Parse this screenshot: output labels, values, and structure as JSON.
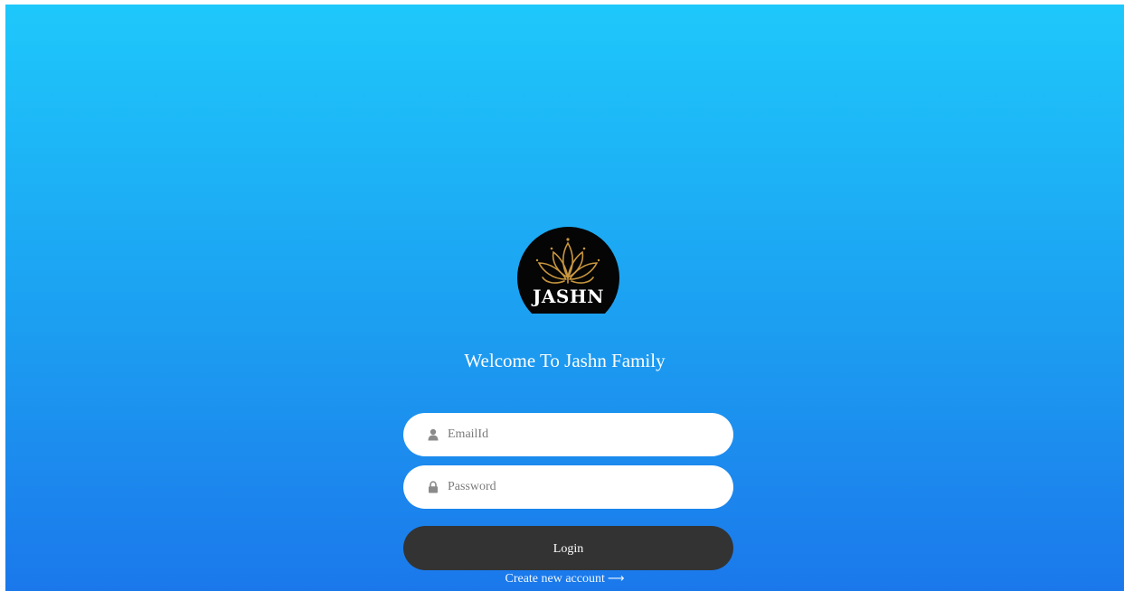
{
  "brand": {
    "logo_text": "JASHN",
    "logo_icon": "lotus-icon",
    "colors": {
      "background_top": "#1ec8fb",
      "background_bottom": "#1b78eb",
      "logo_gold": "#c8963e",
      "button_dark": "#333333"
    }
  },
  "welcome_title": "Welcome To Jashn Family",
  "form": {
    "email": {
      "placeholder": "EmailId",
      "value": "",
      "icon": "user-icon"
    },
    "password": {
      "placeholder": "Password",
      "value": "",
      "icon": "lock-icon"
    },
    "login_label": "Login",
    "create_account_label": "Create new account",
    "create_account_icon": "arrow-right-icon"
  }
}
